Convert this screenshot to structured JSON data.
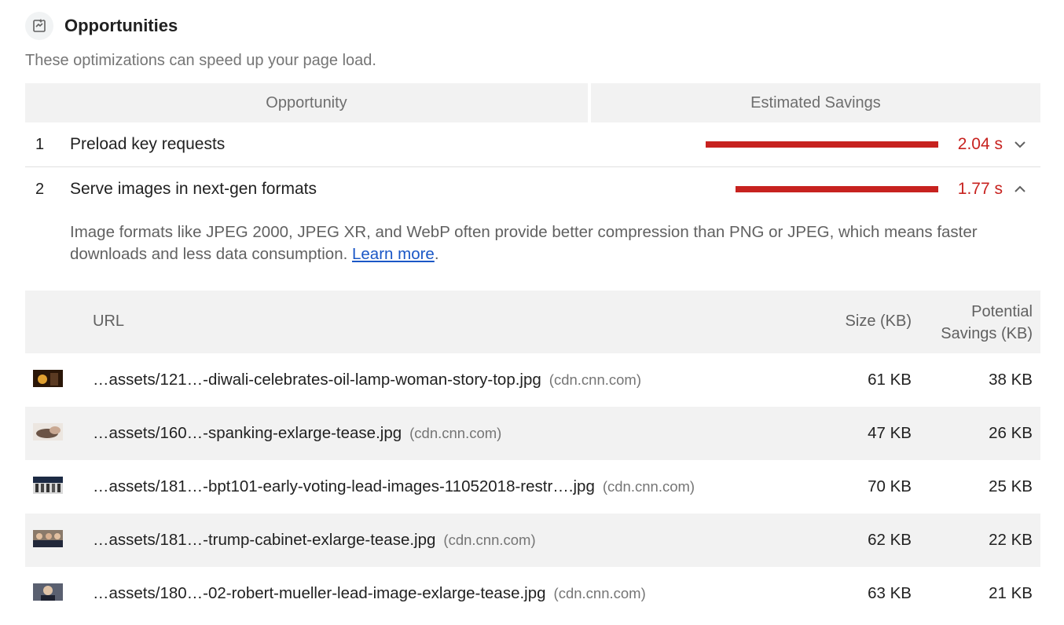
{
  "section": {
    "title": "Opportunities",
    "description": "These optimizations can speed up your page load."
  },
  "table_header": {
    "opportunity": "Opportunity",
    "estimated_savings": "Estimated Savings"
  },
  "opportunities": [
    {
      "num": "1",
      "title": "Preload key requests",
      "value": "2.04 s",
      "bar_fraction": 1.0,
      "expanded": false
    },
    {
      "num": "2",
      "title": "Serve images in next-gen formats",
      "value": "1.77 s",
      "bar_fraction": 0.87,
      "expanded": true
    }
  ],
  "detail_description": {
    "text": "Image formats like JPEG 2000, JPEG XR, and WebP often provide better compression than PNG or JPEG, which means faster downloads and less data consumption. ",
    "link": "Learn more",
    "after": "."
  },
  "details_header": {
    "url": "URL",
    "size": "Size (KB)",
    "savings_line1": "Potential",
    "savings_line2": "Savings (KB)"
  },
  "rows": [
    {
      "url": "…assets/121…-diwali-celebrates-oil-lamp-woman-story-top.jpg",
      "host": "(cdn.cnn.com)",
      "size": "61 KB",
      "savings": "38 KB",
      "thumb": "diwali-thumbnail"
    },
    {
      "url": "…assets/160…-spanking-exlarge-tease.jpg",
      "host": "(cdn.cnn.com)",
      "size": "47 KB",
      "savings": "26 KB",
      "thumb": "spanking-thumbnail"
    },
    {
      "url": "…assets/181…-bpt101-early-voting-lead-images-11052018-restr….jpg",
      "host": "(cdn.cnn.com)",
      "size": "70 KB",
      "savings": "25 KB",
      "thumb": "voting-thumbnail"
    },
    {
      "url": "…assets/181…-trump-cabinet-exlarge-tease.jpg",
      "host": "(cdn.cnn.com)",
      "size": "62 KB",
      "savings": "22 KB",
      "thumb": "cabinet-thumbnail"
    },
    {
      "url": "…assets/180…-02-robert-mueller-lead-image-exlarge-tease.jpg",
      "host": "(cdn.cnn.com)",
      "size": "63 KB",
      "savings": "21 KB",
      "thumb": "mueller-thumbnail"
    }
  ],
  "colors": {
    "fail_red": "#c7221f",
    "link_blue": "#1a57c6",
    "header_bg": "#f2f2f2"
  },
  "icons": {
    "section": "opportunity-icon",
    "collapsed": "chevron-down-icon",
    "expanded": "chevron-up-icon"
  }
}
